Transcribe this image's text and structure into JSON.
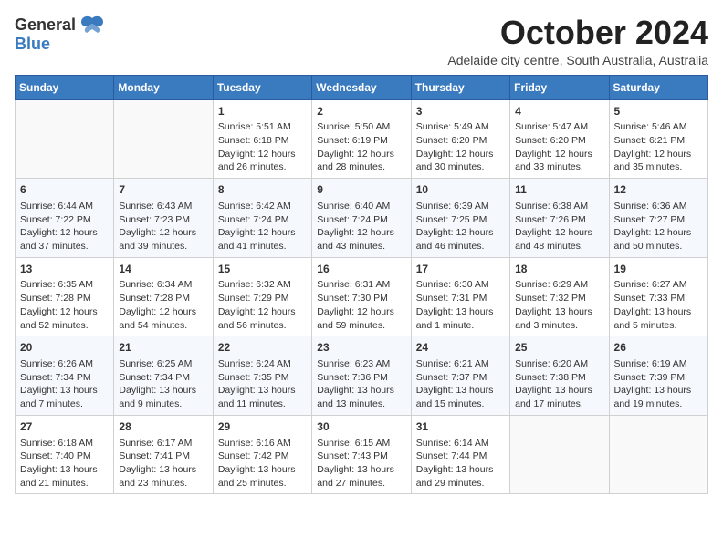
{
  "header": {
    "logo": {
      "line1": "General",
      "line2": "Blue"
    },
    "title": "October 2024",
    "subtitle": "Adelaide city centre, South Australia, Australia"
  },
  "days_of_week": [
    "Sunday",
    "Monday",
    "Tuesday",
    "Wednesday",
    "Thursday",
    "Friday",
    "Saturday"
  ],
  "weeks": [
    [
      {
        "day": "",
        "info": ""
      },
      {
        "day": "",
        "info": ""
      },
      {
        "day": "1",
        "info": "Sunrise: 5:51 AM\nSunset: 6:18 PM\nDaylight: 12 hours\nand 26 minutes."
      },
      {
        "day": "2",
        "info": "Sunrise: 5:50 AM\nSunset: 6:19 PM\nDaylight: 12 hours\nand 28 minutes."
      },
      {
        "day": "3",
        "info": "Sunrise: 5:49 AM\nSunset: 6:20 PM\nDaylight: 12 hours\nand 30 minutes."
      },
      {
        "day": "4",
        "info": "Sunrise: 5:47 AM\nSunset: 6:20 PM\nDaylight: 12 hours\nand 33 minutes."
      },
      {
        "day": "5",
        "info": "Sunrise: 5:46 AM\nSunset: 6:21 PM\nDaylight: 12 hours\nand 35 minutes."
      }
    ],
    [
      {
        "day": "6",
        "info": "Sunrise: 6:44 AM\nSunset: 7:22 PM\nDaylight: 12 hours\nand 37 minutes."
      },
      {
        "day": "7",
        "info": "Sunrise: 6:43 AM\nSunset: 7:23 PM\nDaylight: 12 hours\nand 39 minutes."
      },
      {
        "day": "8",
        "info": "Sunrise: 6:42 AM\nSunset: 7:24 PM\nDaylight: 12 hours\nand 41 minutes."
      },
      {
        "day": "9",
        "info": "Sunrise: 6:40 AM\nSunset: 7:24 PM\nDaylight: 12 hours\nand 43 minutes."
      },
      {
        "day": "10",
        "info": "Sunrise: 6:39 AM\nSunset: 7:25 PM\nDaylight: 12 hours\nand 46 minutes."
      },
      {
        "day": "11",
        "info": "Sunrise: 6:38 AM\nSunset: 7:26 PM\nDaylight: 12 hours\nand 48 minutes."
      },
      {
        "day": "12",
        "info": "Sunrise: 6:36 AM\nSunset: 7:27 PM\nDaylight: 12 hours\nand 50 minutes."
      }
    ],
    [
      {
        "day": "13",
        "info": "Sunrise: 6:35 AM\nSunset: 7:28 PM\nDaylight: 12 hours\nand 52 minutes."
      },
      {
        "day": "14",
        "info": "Sunrise: 6:34 AM\nSunset: 7:28 PM\nDaylight: 12 hours\nand 54 minutes."
      },
      {
        "day": "15",
        "info": "Sunrise: 6:32 AM\nSunset: 7:29 PM\nDaylight: 12 hours\nand 56 minutes."
      },
      {
        "day": "16",
        "info": "Sunrise: 6:31 AM\nSunset: 7:30 PM\nDaylight: 12 hours\nand 59 minutes."
      },
      {
        "day": "17",
        "info": "Sunrise: 6:30 AM\nSunset: 7:31 PM\nDaylight: 13 hours\nand 1 minute."
      },
      {
        "day": "18",
        "info": "Sunrise: 6:29 AM\nSunset: 7:32 PM\nDaylight: 13 hours\nand 3 minutes."
      },
      {
        "day": "19",
        "info": "Sunrise: 6:27 AM\nSunset: 7:33 PM\nDaylight: 13 hours\nand 5 minutes."
      }
    ],
    [
      {
        "day": "20",
        "info": "Sunrise: 6:26 AM\nSunset: 7:34 PM\nDaylight: 13 hours\nand 7 minutes."
      },
      {
        "day": "21",
        "info": "Sunrise: 6:25 AM\nSunset: 7:34 PM\nDaylight: 13 hours\nand 9 minutes."
      },
      {
        "day": "22",
        "info": "Sunrise: 6:24 AM\nSunset: 7:35 PM\nDaylight: 13 hours\nand 11 minutes."
      },
      {
        "day": "23",
        "info": "Sunrise: 6:23 AM\nSunset: 7:36 PM\nDaylight: 13 hours\nand 13 minutes."
      },
      {
        "day": "24",
        "info": "Sunrise: 6:21 AM\nSunset: 7:37 PM\nDaylight: 13 hours\nand 15 minutes."
      },
      {
        "day": "25",
        "info": "Sunrise: 6:20 AM\nSunset: 7:38 PM\nDaylight: 13 hours\nand 17 minutes."
      },
      {
        "day": "26",
        "info": "Sunrise: 6:19 AM\nSunset: 7:39 PM\nDaylight: 13 hours\nand 19 minutes."
      }
    ],
    [
      {
        "day": "27",
        "info": "Sunrise: 6:18 AM\nSunset: 7:40 PM\nDaylight: 13 hours\nand 21 minutes."
      },
      {
        "day": "28",
        "info": "Sunrise: 6:17 AM\nSunset: 7:41 PM\nDaylight: 13 hours\nand 23 minutes."
      },
      {
        "day": "29",
        "info": "Sunrise: 6:16 AM\nSunset: 7:42 PM\nDaylight: 13 hours\nand 25 minutes."
      },
      {
        "day": "30",
        "info": "Sunrise: 6:15 AM\nSunset: 7:43 PM\nDaylight: 13 hours\nand 27 minutes."
      },
      {
        "day": "31",
        "info": "Sunrise: 6:14 AM\nSunset: 7:44 PM\nDaylight: 13 hours\nand 29 minutes."
      },
      {
        "day": "",
        "info": ""
      },
      {
        "day": "",
        "info": ""
      }
    ]
  ]
}
